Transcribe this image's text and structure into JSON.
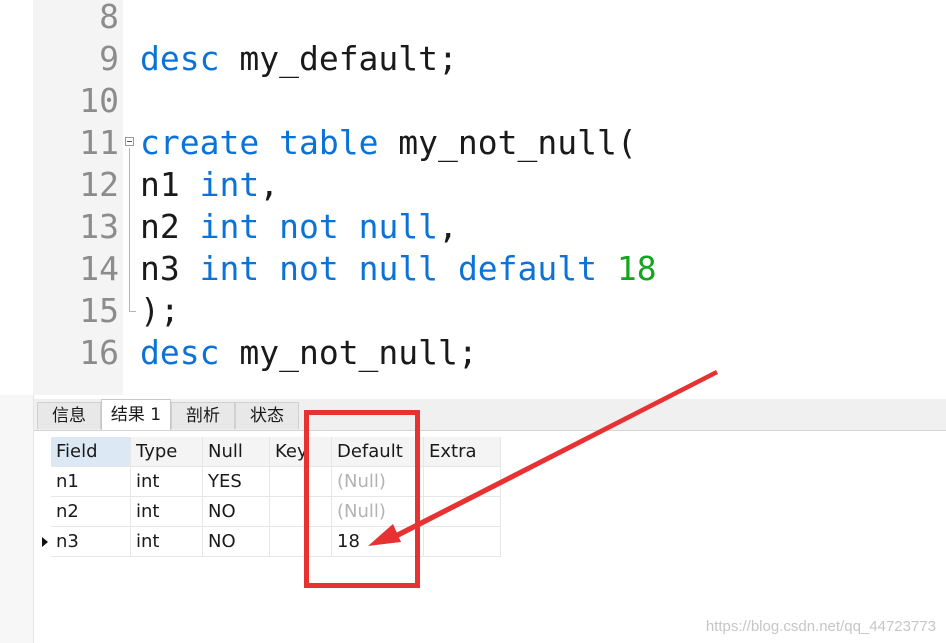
{
  "editor": {
    "lines": [
      {
        "num": "8",
        "tokens": []
      },
      {
        "num": "9",
        "tokens": [
          {
            "t": "desc",
            "k": "kw"
          },
          {
            "t": " my_default;",
            "k": ""
          }
        ]
      },
      {
        "num": "10",
        "tokens": []
      },
      {
        "num": "11",
        "tokens": [
          {
            "t": "create",
            "k": "kw"
          },
          {
            "t": " ",
            "k": ""
          },
          {
            "t": "table",
            "k": "kw"
          },
          {
            "t": " my_not_null(",
            "k": ""
          }
        ]
      },
      {
        "num": "12",
        "tokens": [
          {
            "t": "n1 ",
            "k": ""
          },
          {
            "t": "int",
            "k": "kw"
          },
          {
            "t": ",",
            "k": ""
          }
        ]
      },
      {
        "num": "13",
        "tokens": [
          {
            "t": "n2 ",
            "k": ""
          },
          {
            "t": "int",
            "k": "kw"
          },
          {
            "t": " ",
            "k": ""
          },
          {
            "t": "not",
            "k": "kw"
          },
          {
            "t": " ",
            "k": ""
          },
          {
            "t": "null",
            "k": "kw"
          },
          {
            "t": ",",
            "k": ""
          }
        ]
      },
      {
        "num": "14",
        "tokens": [
          {
            "t": "n3 ",
            "k": ""
          },
          {
            "t": "int",
            "k": "kw"
          },
          {
            "t": " ",
            "k": ""
          },
          {
            "t": "not",
            "k": "kw"
          },
          {
            "t": " ",
            "k": ""
          },
          {
            "t": "null",
            "k": "kw"
          },
          {
            "t": " ",
            "k": ""
          },
          {
            "t": "default",
            "k": "kw"
          },
          {
            "t": " ",
            "k": ""
          },
          {
            "t": "18",
            "k": "num"
          }
        ]
      },
      {
        "num": "15",
        "tokens": [
          {
            "t": ");",
            "k": ""
          }
        ]
      },
      {
        "num": "16",
        "tokens": [
          {
            "t": "desc",
            "k": "kw"
          },
          {
            "t": " my_not_null;",
            "k": ""
          }
        ]
      }
    ]
  },
  "tabs": [
    {
      "label": "信息",
      "active": false
    },
    {
      "label": "结果 1",
      "active": true
    },
    {
      "label": "剖析",
      "active": false
    },
    {
      "label": "状态",
      "active": false
    }
  ],
  "grid": {
    "columns": [
      "Field",
      "Type",
      "Null",
      "Key",
      "Default",
      "Extra"
    ],
    "rows": [
      [
        "n1",
        "int",
        "YES",
        "",
        "(Null)",
        ""
      ],
      [
        "n2",
        "int",
        "NO",
        "",
        "(Null)",
        ""
      ],
      [
        "n3",
        "int",
        "NO",
        "",
        "18",
        ""
      ]
    ],
    "selected_row": 2
  },
  "colors": {
    "keyword": "#0b73d8",
    "number": "#12a51d",
    "annotation": "#e63232"
  },
  "watermark": "https://blog.csdn.net/qq_44723773"
}
